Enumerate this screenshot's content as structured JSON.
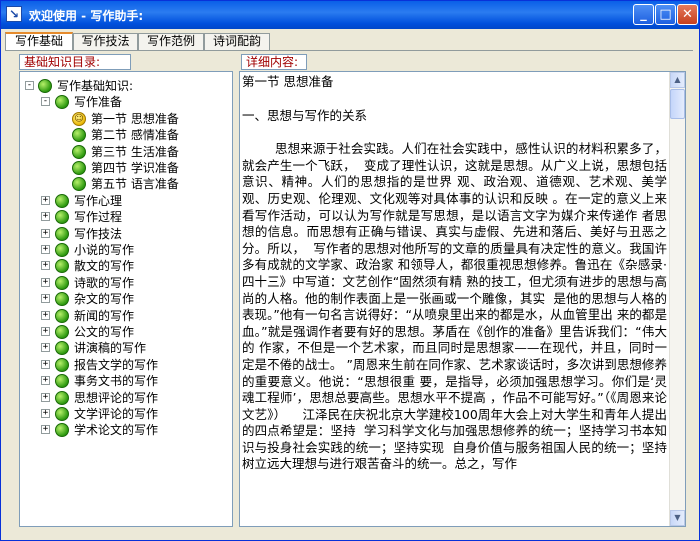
{
  "window": {
    "title": "欢迎使用 - 写作助手:"
  },
  "tabs": [
    "写作基础",
    "写作技法",
    "写作范例",
    "诗词配韵"
  ],
  "left_panel": {
    "label": "基础知识目录:",
    "tree": [
      {
        "label": "写作基础知识:",
        "level": 0,
        "expander": "-"
      },
      {
        "label": "写作准备",
        "level": 1,
        "expander": "-"
      },
      {
        "label": "第一节  思想准备",
        "level": 2,
        "icon": "smile"
      },
      {
        "label": "第二节  感情准备",
        "level": 2
      },
      {
        "label": "第三节  生活准备",
        "level": 2
      },
      {
        "label": "第四节  学识准备",
        "level": 2
      },
      {
        "label": "第五节  语言准备",
        "level": 2
      },
      {
        "label": "写作心理",
        "level": 1,
        "expander": "+"
      },
      {
        "label": "写作过程",
        "level": 1,
        "expander": "+"
      },
      {
        "label": "写作技法",
        "level": 1,
        "expander": "+"
      },
      {
        "label": "小说的写作",
        "level": 1,
        "expander": "+"
      },
      {
        "label": "散文的写作",
        "level": 1,
        "expander": "+"
      },
      {
        "label": "诗歌的写作",
        "level": 1,
        "expander": "+"
      },
      {
        "label": "杂文的写作",
        "level": 1,
        "expander": "+"
      },
      {
        "label": "新闻的写作",
        "level": 1,
        "expander": "+"
      },
      {
        "label": "公文的写作",
        "level": 1,
        "expander": "+"
      },
      {
        "label": "讲演稿的写作",
        "level": 1,
        "expander": "+"
      },
      {
        "label": "报告文学的写作",
        "level": 1,
        "expander": "+"
      },
      {
        "label": "事务文书的写作",
        "level": 1,
        "expander": "+"
      },
      {
        "label": "思想评论的写作",
        "level": 1,
        "expander": "+"
      },
      {
        "label": "文学评论的写作",
        "level": 1,
        "expander": "+"
      },
      {
        "label": "学术论文的写作",
        "level": 1,
        "expander": "+"
      }
    ]
  },
  "right_panel": {
    "label": "详细内容:",
    "heading": "第一节  思想准备",
    "subheading": "一、思想与写作的关系",
    "body": "        思想来源于社会实践。人们在社会实践中，感性认识的材料积累多了，就会产生一个飞跃，  变成了理性认识，这就是思想。从广义上说，思想包括意识、精神。人们的思想指的是世界 观、政治观、道德观、艺术观、美学观、历史观、伦理观、文化观等对具体事的认识和反映 。在一定的意义上来看写作活动，可以认为写作就是写思想，是以语言文字为媒介来传递作 者思想的信息。而思想有正确与错误、真实与虚假、先进和落后、美好与丑恶之分。所以，  写作者的思想对他所写的文章的质量具有决定性的意义。我国许多有成就的文学家、政治家 和领导人，都很重视思想修养。鲁迅在《杂感录·四十三》中写道：文艺创作“固然须有精 熟的技工，但尤须有进步的思想与高尚的人格。他的制作表面上是一张画或一个雕像，其实  是他的思想与人格的表现。”他有一句名言说得好：“从喷泉里出来的都是水，从血管里出 来的都是血。”就是强调作者要有好的思想。茅盾在《创作的准备》里告诉我们：“伟大的 作家，不但是一个艺术家，而且同时是思想家——在现代，并且，同时一定是不倦的战士。 ”周恩来生前在同作家、艺术家谈话时，多次讲到思想修养的重要意义。他说：“思想很重 要，是指导，必须加强思想学习。你们是‘灵魂工程师’，思想总要高些。思想水平不提高 ，作品不可能写好。”（《周恩来论文艺》）    江泽民在庆祝北京大学建校100周年大会上对大学生和青年人提出的四点希望是：坚持  学习科学文化与加强思想修养的统一；坚持学习书本知识与投身社会实践的统一；坚持实现  自身价值与服务祖国人民的统一；坚持树立远大理想与进行艰苦奋斗的统一。总之，写作"
  },
  "colors": {
    "title_bar": "#0a5fe8",
    "panel_label_text": "#a00000",
    "pane_border": "#7f9db9"
  }
}
